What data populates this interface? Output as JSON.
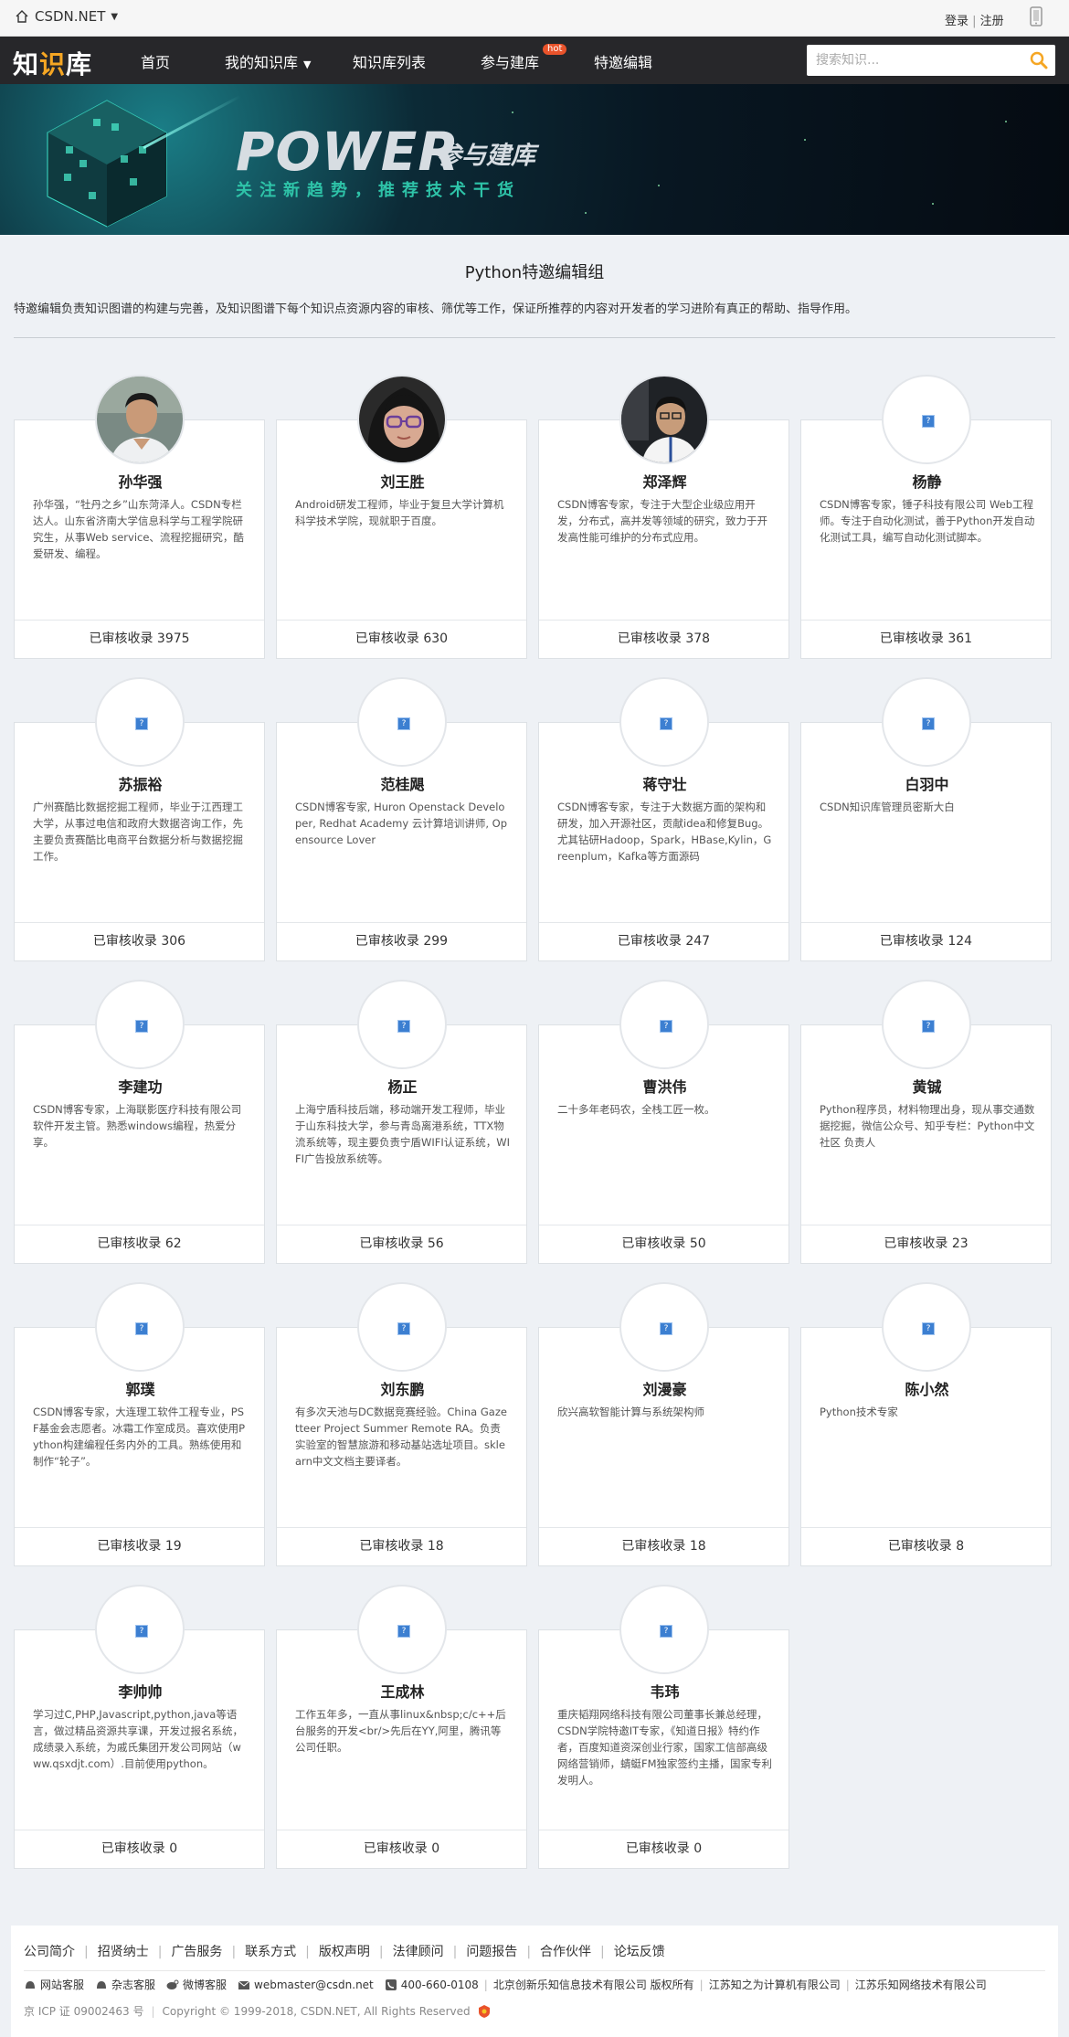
{
  "topbar": {
    "brand": "CSDN.NET",
    "login": "登录",
    "register": "注册"
  },
  "nav": {
    "logo": {
      "a": "知",
      "b": "识",
      "c": "库"
    },
    "items": [
      "首页",
      "我的知识库",
      "知识库列表",
      "参与建库",
      "特邀编辑"
    ],
    "hot_badge": "hot",
    "search_placeholder": "搜索知识..."
  },
  "banner": {
    "title": "POWER",
    "title2": "参与建库",
    "slogan": "关注新趋势，推荐技术干货"
  },
  "group": {
    "title": "Python特邀编辑组",
    "desc": "特邀编辑负责知识图谱的构建与完善，及知识图谱下每个知识点资源内容的审核、筛优等工作，保证所推荐的内容对开发者的学习进阶有真正的帮助、指导作用。"
  },
  "count_prefix": "已审核收录 ",
  "editors": [
    {
      "name": "孙华强",
      "bio": "孙华强，“牡丹之乡”山东菏泽人。CSDN专栏达人。山东省济南大学信息科学与工程学院研究生，从事Web service、流程挖掘研究，酷爱研发、编程。",
      "count": "3975",
      "photo": "man1"
    },
    {
      "name": "刘王胜",
      "bio": "Android研发工程师，毕业于复旦大学计算机科学技术学院，现就职于百度。",
      "count": "630",
      "photo": "woman"
    },
    {
      "name": "郑泽辉",
      "bio": "CSDN博客专家，专注于大型企业级应用开发，分布式，高并发等领域的研究，致力于开发高性能可维护的分布式应用。",
      "count": "378",
      "photo": "man2"
    },
    {
      "name": "杨静",
      "bio": "CSDN博客专家，锤子科技有限公司 Web工程师。专注于自动化测试，善于Python开发自动化测试工具，编写自动化测试脚本。",
      "count": "361",
      "photo": ""
    },
    {
      "name": "苏振裕",
      "bio": "广州赛酷比数据挖掘工程师，毕业于江西理工大学，从事过电信和政府大数据咨询工作，先主要负责赛酷比电商平台数据分析与数据挖掘工作。",
      "count": "306",
      "photo": ""
    },
    {
      "name": "范桂飓",
      "bio": "CSDN博客专家, Huron Openstack Developer, Redhat Academy 云计算培训讲师, Opensource Lover",
      "count": "299",
      "photo": ""
    },
    {
      "name": "蒋守壮",
      "bio": "CSDN博客专家，专注于大数据方面的架构和研发，加入开源社区，贡献idea和修复Bug。尤其钻研Hadoop，Spark，HBase,Kylin，Greenplum，Kafka等方面源码",
      "count": "247",
      "photo": ""
    },
    {
      "name": "白羽中",
      "bio": "CSDN知识库管理员密斯大白",
      "count": "124",
      "photo": ""
    },
    {
      "name": "李建功",
      "bio": "CSDN博客专家，上海联影医疗科技有限公司软件开发主管。熟悉windows编程，热爱分享。",
      "count": "62",
      "photo": ""
    },
    {
      "name": "杨正",
      "bio": "上海宁盾科技后端，移动端开发工程师，毕业于山东科技大学，参与青岛离港系统，TTX物流系统等，现主要负责宁盾WIFI认证系统，WIFI广告投放系统等。",
      "count": "56",
      "photo": ""
    },
    {
      "name": "曹洪伟",
      "bio": "二十多年老码农，全栈工匠一枚。",
      "count": "50",
      "photo": ""
    },
    {
      "name": "黄铖",
      "bio": "Python程序员，材料物理出身，现从事交通数据挖掘，微信公众号、知乎专栏：Python中文社区 负责人",
      "count": "23",
      "photo": ""
    },
    {
      "name": "郭璞",
      "bio": "CSDN博客专家，大连理工软件工程专业，PSF基金会志愿者。冰霜工作室成员。喜欢使用Python构建编程任务内外的工具。熟练使用和制作“轮子”。",
      "count": "19",
      "photo": ""
    },
    {
      "name": "刘东鹏",
      "bio": "有多次天池与DC数据竞赛经验。China Gazetteer Project Summer Remote RA。负责实验室的智慧旅游和移动基站选址项目。sklearn中文文档主要译者。",
      "count": "18",
      "photo": ""
    },
    {
      "name": "刘漫豪",
      "bio": "欣兴高软智能计算与系统架构师",
      "count": "18",
      "photo": ""
    },
    {
      "name": "陈小然",
      "bio": "Python技术专家",
      "count": "8",
      "photo": ""
    },
    {
      "name": "李帅帅",
      "bio": "学习过C,PHP,Javascript,python,java等语言，做过精品资源共享课，开发过报名系统，成绩录入系统，为戚氏集团开发公司网站（www.qsxdjt.com）.目前使用python。",
      "count": "0",
      "photo": ""
    },
    {
      "name": "王成林",
      "bio": "工作五年多，一直从事linux&nbsp;c/c++后台服务的开发<br/>先后在YY,阿里，腾讯等公司任职。",
      "count": "0",
      "photo": ""
    },
    {
      "name": "韦玮",
      "bio": "重庆韬翔网络科技有限公司董事长兼总经理，CSDN学院特邀IT专家，《知道日报》特约作者，百度知道资深创业行家，国家工信部高级网络营销师，蜻蜓FM独家签约主播，国家专利发明人。",
      "count": "0",
      "photo": ""
    }
  ],
  "footer": {
    "links": [
      "公司简介",
      "招贤纳士",
      "广告服务",
      "联系方式",
      "版权声明",
      "法律顾问",
      "问题报告",
      "合作伙伴",
      "论坛反馈"
    ],
    "contacts": [
      "网站客服",
      "杂志客服",
      "微博客服",
      "webmaster@csdn.net",
      "400-660-0108"
    ],
    "companies": [
      "北京创新乐知信息技术有限公司 版权所有",
      "江苏知之为计算机有限公司",
      "江苏乐知网络技术有限公司"
    ],
    "icp": "京 ICP 证 09002463 号",
    "copyright": "Copyright © 1999-2018, CSDN.NET, All Rights Reserved"
  },
  "colors": {
    "nav_bg": "#27272a",
    "accent": "#f5a623",
    "hot": "#e9532b",
    "page_bg": "#eef1f5"
  }
}
